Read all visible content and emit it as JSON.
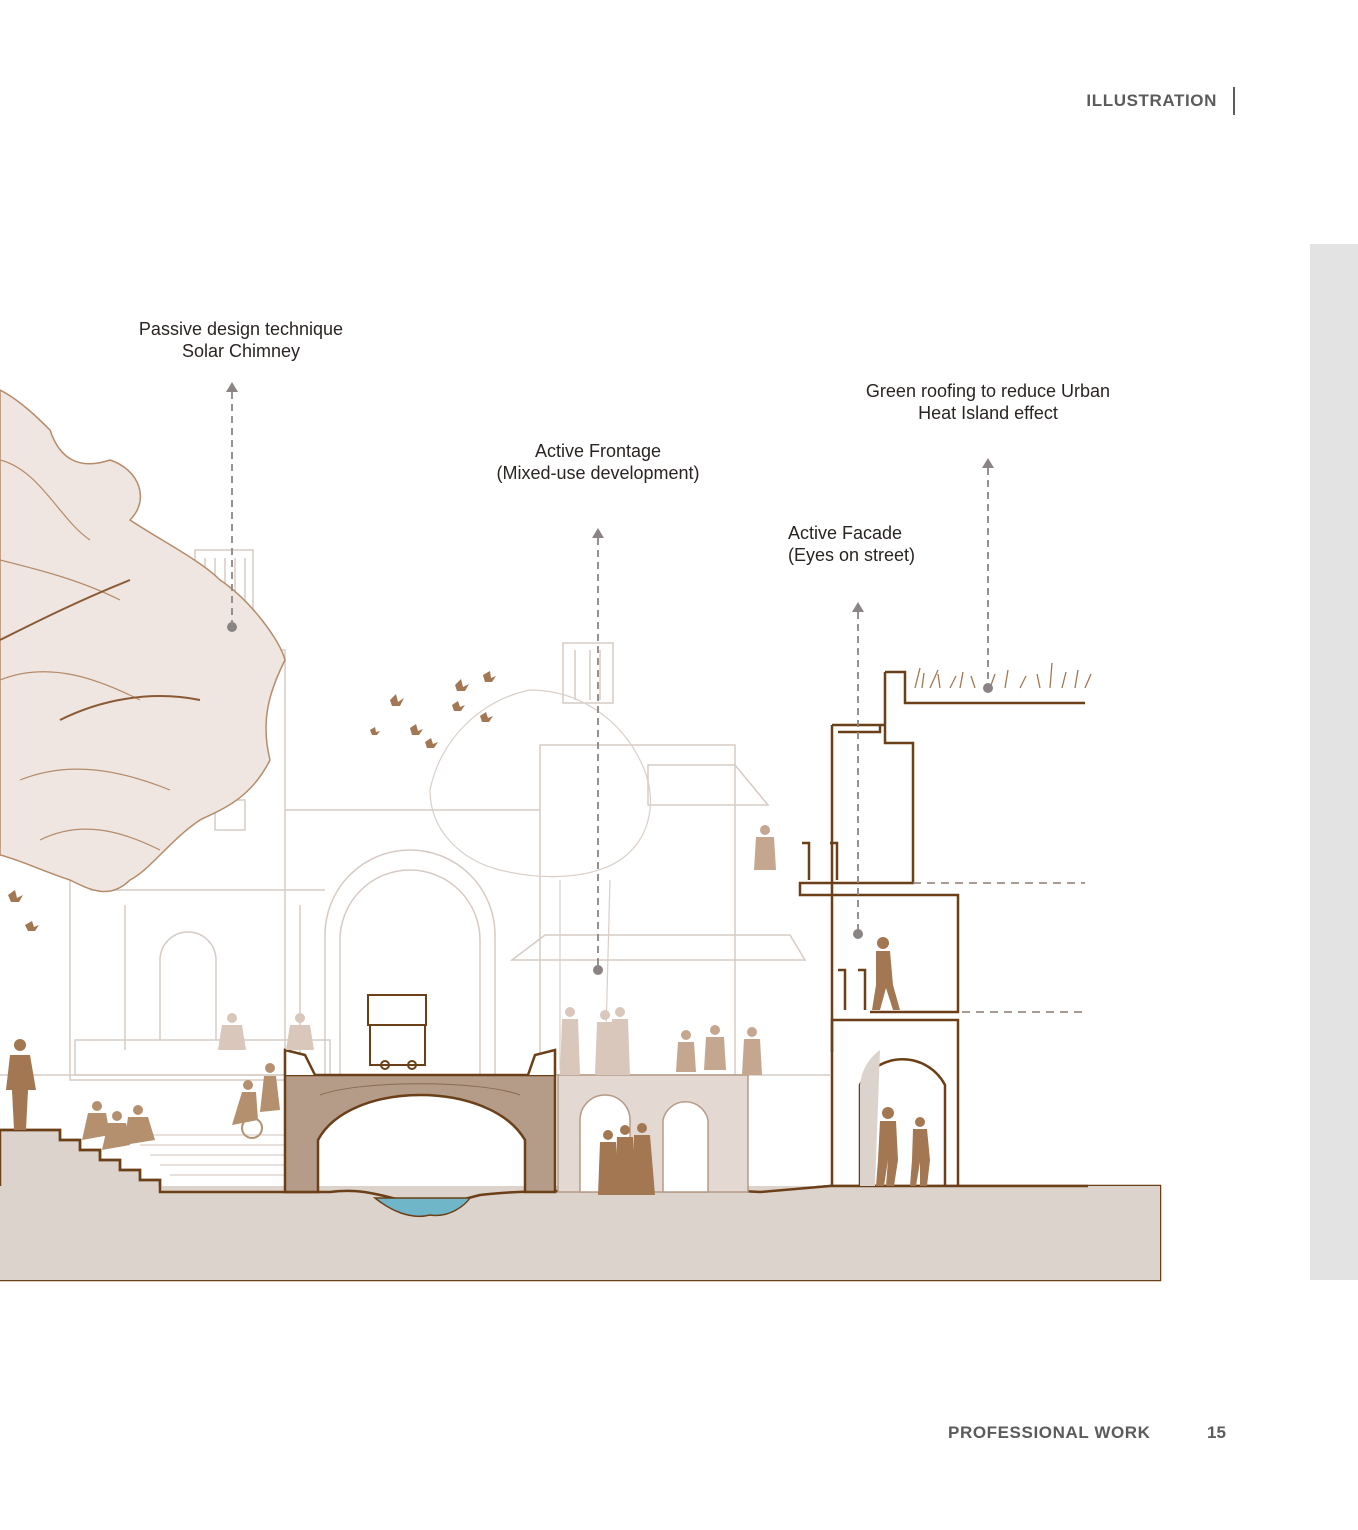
{
  "header": {
    "section_title": "ILLUSTRATION"
  },
  "annotations": [
    {
      "line1": "Passive design technique",
      "line2": "Solar Chimney"
    },
    {
      "line1": "Active Frontage",
      "line2": "(Mixed-use development)"
    },
    {
      "line1": "Active Facade",
      "line2": "(Eyes on street)"
    },
    {
      "line1": "Green roofing to reduce Urban",
      "line2": "Heat Island effect"
    }
  ],
  "footer": {
    "label": "PROFESSIONAL WORK",
    "page_number": "15"
  },
  "colors": {
    "ground": "#ddd3cd",
    "line_brown": "#6b3f17",
    "figure_brown": "#a27752",
    "faint_line": "#cfc3bb",
    "water": "#6fb6c9",
    "leader": "#8a8584",
    "tree_fill": "#efe6e1",
    "side_strip": "#e3e3e3"
  }
}
